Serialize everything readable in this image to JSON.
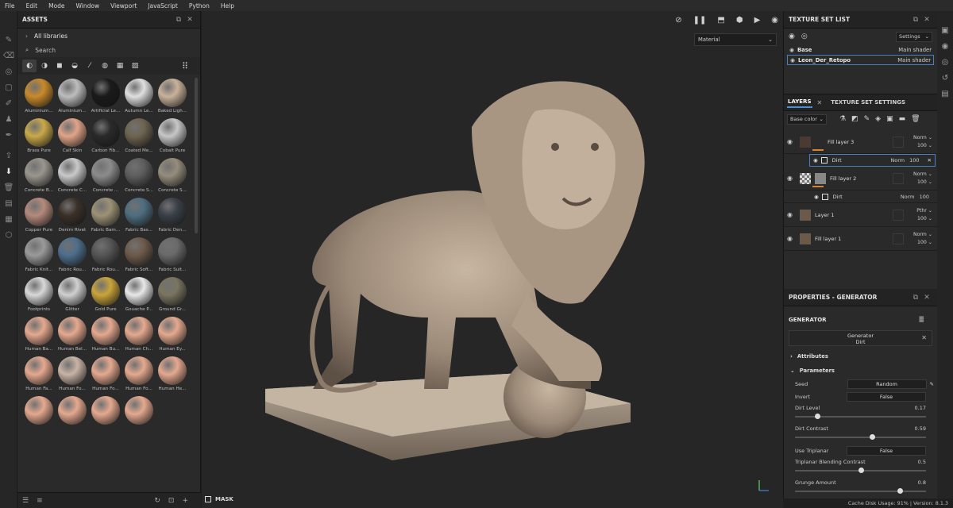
{
  "menu": [
    "File",
    "Edit",
    "Mode",
    "Window",
    "Viewport",
    "JavaScript",
    "Python",
    "Help"
  ],
  "assets": {
    "title": "ASSETS",
    "library": "All libraries",
    "search_placeholder": "Search",
    "materials": [
      {
        "name": "Aluminium...",
        "color": "#c98a2a"
      },
      {
        "name": "Aluminium...",
        "color": "#bdbdbd"
      },
      {
        "name": "Artificial Le...",
        "color": "#1a1a1a"
      },
      {
        "name": "Autumn Le...",
        "color": "#e0e0e0"
      },
      {
        "name": "Baked Ligh...",
        "color": "#c9b29a"
      },
      {
        "name": "Brass Pure",
        "color": "#c9a94a"
      },
      {
        "name": "Calf Skin",
        "color": "#e0a488"
      },
      {
        "name": "Carbon Fib...",
        "color": "#2a2a2a"
      },
      {
        "name": "Coated Me...",
        "color": "#6e6450"
      },
      {
        "name": "Cobalt Pure",
        "color": "#c7c7c7"
      },
      {
        "name": "Concrete B...",
        "color": "#9a968e"
      },
      {
        "name": "Concrete C...",
        "color": "#c9c9c9"
      },
      {
        "name": "Concrete ...",
        "color": "#8c8c8c"
      },
      {
        "name": "Concrete S...",
        "color": "#5e5e5e"
      },
      {
        "name": "Concrete S...",
        "color": "#958d7c"
      },
      {
        "name": "Copper Pure",
        "color": "#b58a7c"
      },
      {
        "name": "Denim Rivet",
        "color": "#3a3028"
      },
      {
        "name": "Fabric Bam...",
        "color": "#9d9276"
      },
      {
        "name": "Fabric Bas...",
        "color": "#4e6e80"
      },
      {
        "name": "Fabric Den...",
        "color": "#3a4048"
      },
      {
        "name": "Fabric Knit...",
        "color": "#9a9a9a"
      },
      {
        "name": "Fabric Rou...",
        "color": "#4e6e8c"
      },
      {
        "name": "Fabric Rou...",
        "color": "#555555"
      },
      {
        "name": "Fabric Soft...",
        "color": "#6e5a4a"
      },
      {
        "name": "Fabric Suit...",
        "color": "#6a6a6a"
      },
      {
        "name": "Footprints",
        "color": "#d8d8d8"
      },
      {
        "name": "Glitter",
        "color": "#d0d0d0"
      },
      {
        "name": "Gold Pure",
        "color": "#c9a43a"
      },
      {
        "name": "Gouache P...",
        "color": "#e8e8e8"
      },
      {
        "name": "Ground Gr...",
        "color": "#7a7560"
      },
      {
        "name": "Human Ba...",
        "color": "#e5a98f"
      },
      {
        "name": "Human Bel...",
        "color": "#e5a98f"
      },
      {
        "name": "Human Bu...",
        "color": "#e5a98f"
      },
      {
        "name": "Human Ch...",
        "color": "#e5a98f"
      },
      {
        "name": "Human Ey...",
        "color": "#e5a98f"
      },
      {
        "name": "Human Fa...",
        "color": "#e5a98f"
      },
      {
        "name": "Human Fo...",
        "color": "#c9b4a6"
      },
      {
        "name": "Human Fo...",
        "color": "#e5a98f"
      },
      {
        "name": "Human Fo...",
        "color": "#e5a98f"
      },
      {
        "name": "Human He...",
        "color": "#e5a98f"
      },
      {
        "name": "",
        "color": "#e5a98f"
      },
      {
        "name": "",
        "color": "#e5a98f"
      },
      {
        "name": "",
        "color": "#e5a98f"
      },
      {
        "name": "",
        "color": "#e5a98f"
      }
    ]
  },
  "viewport": {
    "material_mode": "Material",
    "mask_label": "MASK"
  },
  "texture_set_list": {
    "title": "TEXTURE SET LIST",
    "settings_label": "Settings",
    "rows": [
      {
        "name": "Base",
        "shader": "Main shader"
      },
      {
        "name": "Leon_Der_Retopo",
        "shader": "Main shader"
      }
    ]
  },
  "layers": {
    "tab_layers": "LAYERS",
    "tab_settings": "TEXTURE SET SETTINGS",
    "channel": "Base color",
    "items": [
      {
        "name": "Fill layer 3",
        "blend": "Norm",
        "opacity": "100"
      },
      {
        "name": "Fill layer 2",
        "blend": "Norm",
        "opacity": "100"
      },
      {
        "name": "Layer 1",
        "blend": "Pthr",
        "opacity": "100"
      },
      {
        "name": "Fill layer 1",
        "blend": "Norm",
        "opacity": "100"
      }
    ],
    "dirt_a": {
      "name": "Dirt",
      "blend": "Norm",
      "opacity": "100"
    },
    "dirt_b": {
      "name": "Dirt",
      "blend": "Norm",
      "opacity": "100"
    }
  },
  "properties": {
    "title": "PROPERTIES - GENERATOR",
    "section": "GENERATOR",
    "gen_title": "Generator",
    "gen_name": "Dirt",
    "attributes": "Attributes",
    "parameters": "Parameters",
    "seed_label": "Seed",
    "seed_value": "Random",
    "invert_label": "Invert",
    "invert_value": "False",
    "dirt_level_label": "Dirt Level",
    "dirt_level_value": "0.17",
    "dirt_level": 0.17,
    "dirt_contrast_label": "Dirt Contrast",
    "dirt_contrast_value": "0.59",
    "dirt_contrast": 0.59,
    "triplanar_label": "Use Triplanar",
    "triplanar_value": "False",
    "tri_blend_label": "Triplanar Blending Contrast",
    "tri_blend_value": "0.5",
    "tri_blend": 0.5,
    "grunge_label": "Grunge Amount",
    "grunge_value": "0.8",
    "grunge": 0.8
  },
  "status": "Cache Disk Usage:   91% | Version: 8.1.3"
}
